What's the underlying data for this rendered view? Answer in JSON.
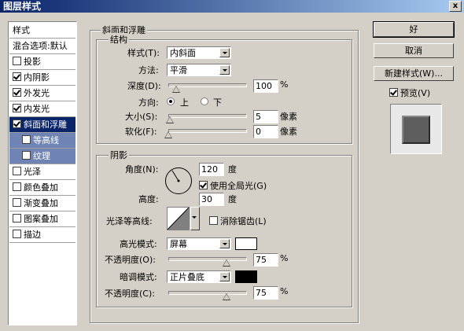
{
  "window": {
    "title": "图层样式",
    "close": "x"
  },
  "sidebar": {
    "items": [
      {
        "label": "样式",
        "checkbox": false,
        "checked": false
      },
      {
        "label": "混合选项:默认",
        "checkbox": false,
        "checked": false
      },
      {
        "label": "投影",
        "checkbox": true,
        "checked": false
      },
      {
        "label": "内阴影",
        "checkbox": true,
        "checked": true
      },
      {
        "label": "外发光",
        "checkbox": true,
        "checked": true
      },
      {
        "label": "内发光",
        "checkbox": true,
        "checked": true
      },
      {
        "label": "斜面和浮雕",
        "checkbox": true,
        "checked": true
      },
      {
        "label": "等高线",
        "checkbox": true,
        "checked": false
      },
      {
        "label": "纹理",
        "checkbox": true,
        "checked": false
      },
      {
        "label": "光泽",
        "checkbox": true,
        "checked": false
      },
      {
        "label": "颜色叠加",
        "checkbox": true,
        "checked": false
      },
      {
        "label": "渐变叠加",
        "checkbox": true,
        "checked": false
      },
      {
        "label": "图案叠加",
        "checkbox": true,
        "checked": false
      },
      {
        "label": "描边",
        "checkbox": true,
        "checked": false
      }
    ]
  },
  "bevel": {
    "title": "斜面和浮雕",
    "structure": {
      "title": "结构",
      "style_label": "样式(T):",
      "style_value": "内斜面",
      "technique_label": "方法:",
      "technique_value": "平滑",
      "depth_label": "深度(D):",
      "depth_value": "100",
      "depth_fraction": 0.1,
      "direction_label": "方向:",
      "direction_up": "上",
      "direction_down": "下",
      "direction_selected": "上",
      "size_label": "大小(S):",
      "size_value": "5",
      "size_fraction": 0.02,
      "size_unit": "像素",
      "soften_label": "软化(F):",
      "soften_value": "0",
      "soften_fraction": 0,
      "soften_unit": "像素",
      "percent": "%"
    },
    "shading": {
      "title": "阴影",
      "angle_label": "角度(N):",
      "angle_value": "120",
      "angle_unit": "度",
      "global_light_label": "使用全局光(G)",
      "global_light_checked": true,
      "altitude_label": "高度:",
      "altitude_value": "30",
      "altitude_unit": "度",
      "gloss_contour_label": "光泽等高线:",
      "antialias_label": "消除锯齿(L)",
      "antialias_checked": false,
      "highlight_mode_label": "高光模式:",
      "highlight_mode_value": "屏幕",
      "highlight_color": "#ffffff",
      "highlight_opacity_label": "不透明度(O):",
      "highlight_opacity_value": "75",
      "highlight_opacity_fraction": 0.75,
      "shadow_mode_label": "暗调模式:",
      "shadow_mode_value": "正片叠底",
      "shadow_color": "#000000",
      "shadow_opacity_label": "不透明度(C):",
      "shadow_opacity_value": "75",
      "shadow_opacity_fraction": 0.75,
      "percent": "%"
    }
  },
  "buttons": {
    "ok": "好",
    "cancel": "取消",
    "new_style": "新建样式(W)...",
    "preview_label": "预览(V)",
    "preview_checked": true
  }
}
